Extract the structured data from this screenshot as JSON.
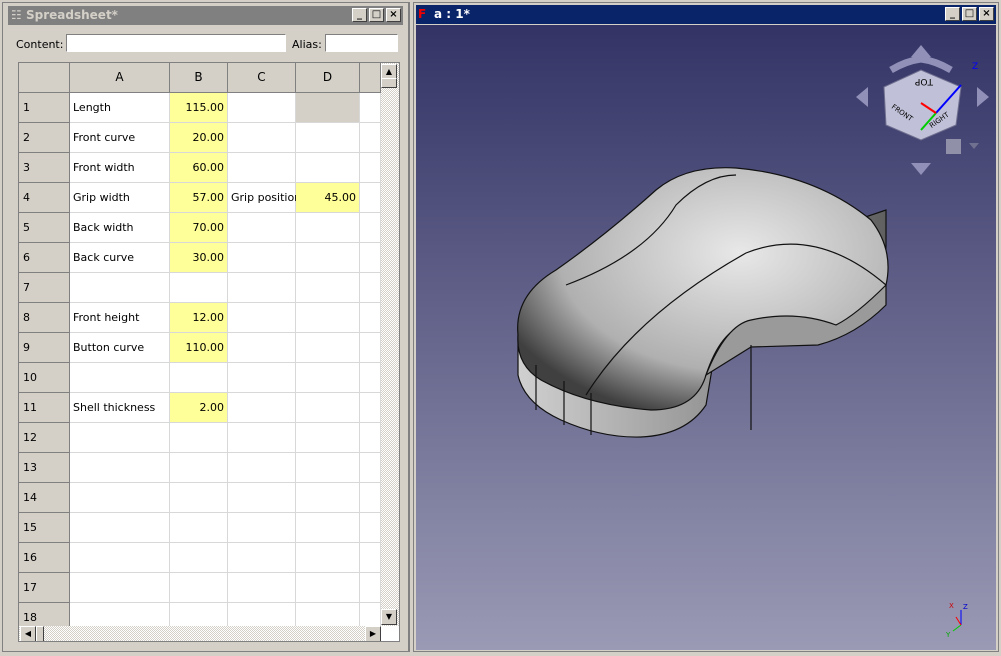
{
  "spreadsheet": {
    "title": "Spreadsheet*",
    "content_label": "Content:",
    "content_value": "",
    "alias_label": "Alias:",
    "alias_value": "",
    "columns": [
      "A",
      "B",
      "C",
      "D"
    ],
    "rows": [
      {
        "n": "1",
        "a": "Length",
        "b": "115.00",
        "c": "",
        "d": ""
      },
      {
        "n": "2",
        "a": "Front curve",
        "b": "20.00",
        "c": "",
        "d": ""
      },
      {
        "n": "3",
        "a": "Front width",
        "b": "60.00",
        "c": "",
        "d": ""
      },
      {
        "n": "4",
        "a": "Grip width",
        "b": "57.00",
        "c": "Grip position",
        "d": "45.00"
      },
      {
        "n": "5",
        "a": "Back width",
        "b": "70.00",
        "c": "",
        "d": ""
      },
      {
        "n": "6",
        "a": "Back curve",
        "b": "30.00",
        "c": "",
        "d": ""
      },
      {
        "n": "7",
        "a": "",
        "b": "",
        "c": "",
        "d": ""
      },
      {
        "n": "8",
        "a": "Front height",
        "b": "12.00",
        "c": "",
        "d": ""
      },
      {
        "n": "9",
        "a": "Button curve",
        "b": "110.00",
        "c": "",
        "d": ""
      },
      {
        "n": "10",
        "a": "",
        "b": "",
        "c": "",
        "d": ""
      },
      {
        "n": "11",
        "a": "Shell thickness",
        "b": "2.00",
        "c": "",
        "d": ""
      },
      {
        "n": "12",
        "a": "",
        "b": "",
        "c": "",
        "d": ""
      },
      {
        "n": "13",
        "a": "",
        "b": "",
        "c": "",
        "d": ""
      },
      {
        "n": "14",
        "a": "",
        "b": "",
        "c": "",
        "d": ""
      },
      {
        "n": "15",
        "a": "",
        "b": "",
        "c": "",
        "d": ""
      },
      {
        "n": "16",
        "a": "",
        "b": "",
        "c": "",
        "d": ""
      },
      {
        "n": "17",
        "a": "",
        "b": "",
        "c": "",
        "d": ""
      },
      {
        "n": "18",
        "a": "",
        "b": "",
        "c": "",
        "d": ""
      }
    ]
  },
  "viewer": {
    "title": "a : 1*",
    "cube_faces": {
      "top": "TOP",
      "front": "FRONT",
      "right": "RIGHT"
    },
    "axes": {
      "x": "X",
      "y": "Y",
      "z": "Z"
    }
  },
  "colors": {
    "title_active": "#0a246a",
    "title_inactive": "#808080",
    "param_cell": "#ffff99",
    "viewport_top": "#333366",
    "viewport_bottom": "#9a9ab5"
  }
}
